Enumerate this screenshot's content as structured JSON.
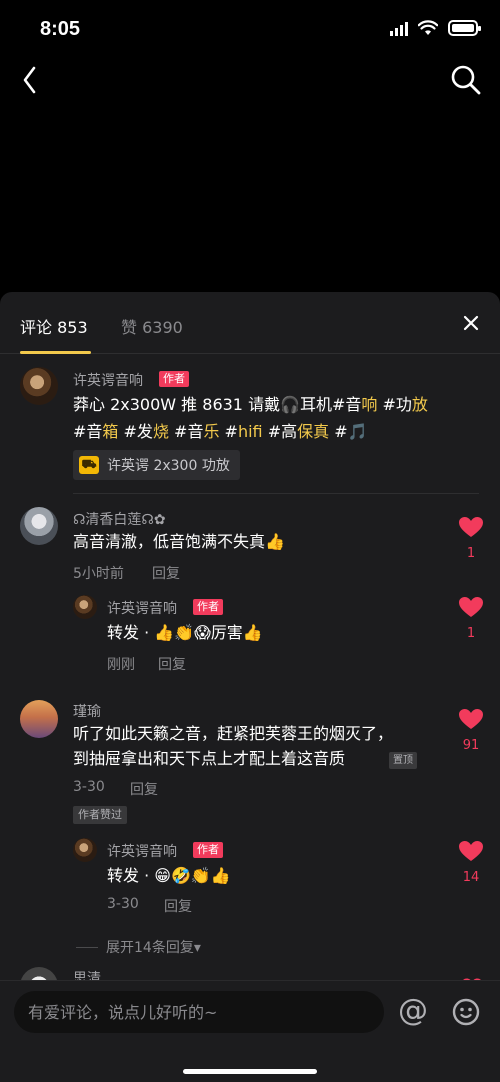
{
  "status_bar": {
    "time": "8:05"
  },
  "tabs": {
    "comments": "评论 853",
    "likes": "赞 6390"
  },
  "comments": [
    {
      "author": "许英谔音响",
      "tag": "作者",
      "text_parts": [
        "莽心 2x300W 推 8631 请戴🎧耳机#音",
        "响",
        " #功",
        "放",
        " #音",
        "箱",
        " #发",
        "烧",
        " #音",
        "乐",
        " #",
        "hifi",
        " #高",
        "保真",
        " #🎵"
      ],
      "product": "许英谔 2x300 功放"
    },
    {
      "author": "☊清香白莲☊✿",
      "text": "高音清澈，低音饱满不失真👍",
      "time": "5小时前",
      "reply": "回复",
      "likes": "1",
      "replies": [
        {
          "author": "许英谔音响",
          "tag": "作者",
          "text": "转发 · 👍👏😱厉害👍",
          "time": "刚刚",
          "reply": "回复",
          "likes": "1"
        }
      ]
    },
    {
      "author": "瑾瑜",
      "text_line1": "听了如此天籁之音，赶紧把芙蓉王的烟灭了，",
      "text_line2": "到抽屉拿出和天下点上才配上着这音质",
      "pin": "置顶",
      "time": "3-30",
      "reply": "回复",
      "likes": "91",
      "author_liked": "作者赞过",
      "replies": [
        {
          "author": "许英谔音响",
          "tag": "作者",
          "text": "转发 · 😁🤣👏👍",
          "time": "3-30",
          "reply": "回复",
          "likes": "14"
        }
      ],
      "expand": "展开14条回复▾"
    },
    {
      "author": "思清"
    }
  ],
  "input": {
    "placeholder": "有爱评论，说点儿好听的~",
    "at": "@"
  }
}
